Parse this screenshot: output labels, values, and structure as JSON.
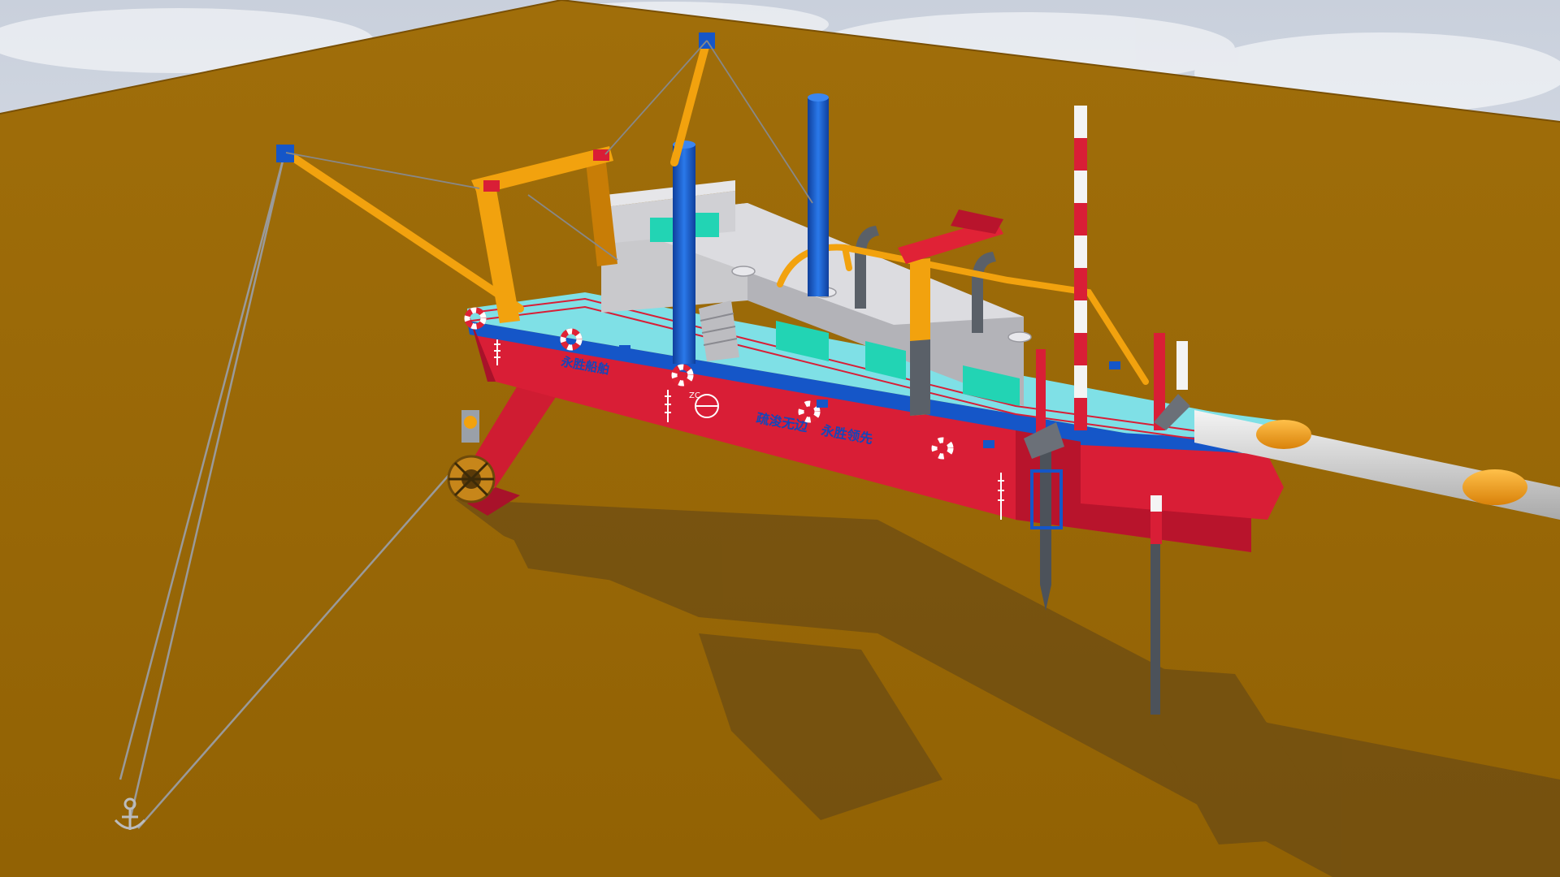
{
  "scene": {
    "subject": "cutter-suction-dredger",
    "colors": {
      "sky_top": "#d9dde6",
      "sky_bottom": "#ffffff",
      "seabed": "#9a6608",
      "seabed_dark": "#8a5a04",
      "hull_red": "#d91e36",
      "hull_red_dark": "#a8122a",
      "hull_blue": "#1556c8",
      "deck_cyan": "#7fe0e6",
      "cabin_grey": "#c9c9cc",
      "cabin_grey_dark": "#9a9aa0",
      "window_teal": "#22d4b4",
      "gantry_orange": "#f2a20e",
      "gantry_orange_dark": "#c87d06",
      "mast_blue": "#1a63d6",
      "spud_grey": "#5a6068",
      "pipe_white": "#dcdcdc",
      "float_orange": "#f3a21a",
      "cable_grey": "#8c8c8c",
      "shadow": "#4a3a1c"
    },
    "hull_text": {
      "bow_name": "永胜船舶",
      "slogan_left": "疏浚无边",
      "slogan_right": "永胜领先",
      "logo_letters": "ZC"
    },
    "icons": [
      "life-ring-icon",
      "draft-scale-icon",
      "company-logo-icon",
      "anchor-icon"
    ]
  }
}
